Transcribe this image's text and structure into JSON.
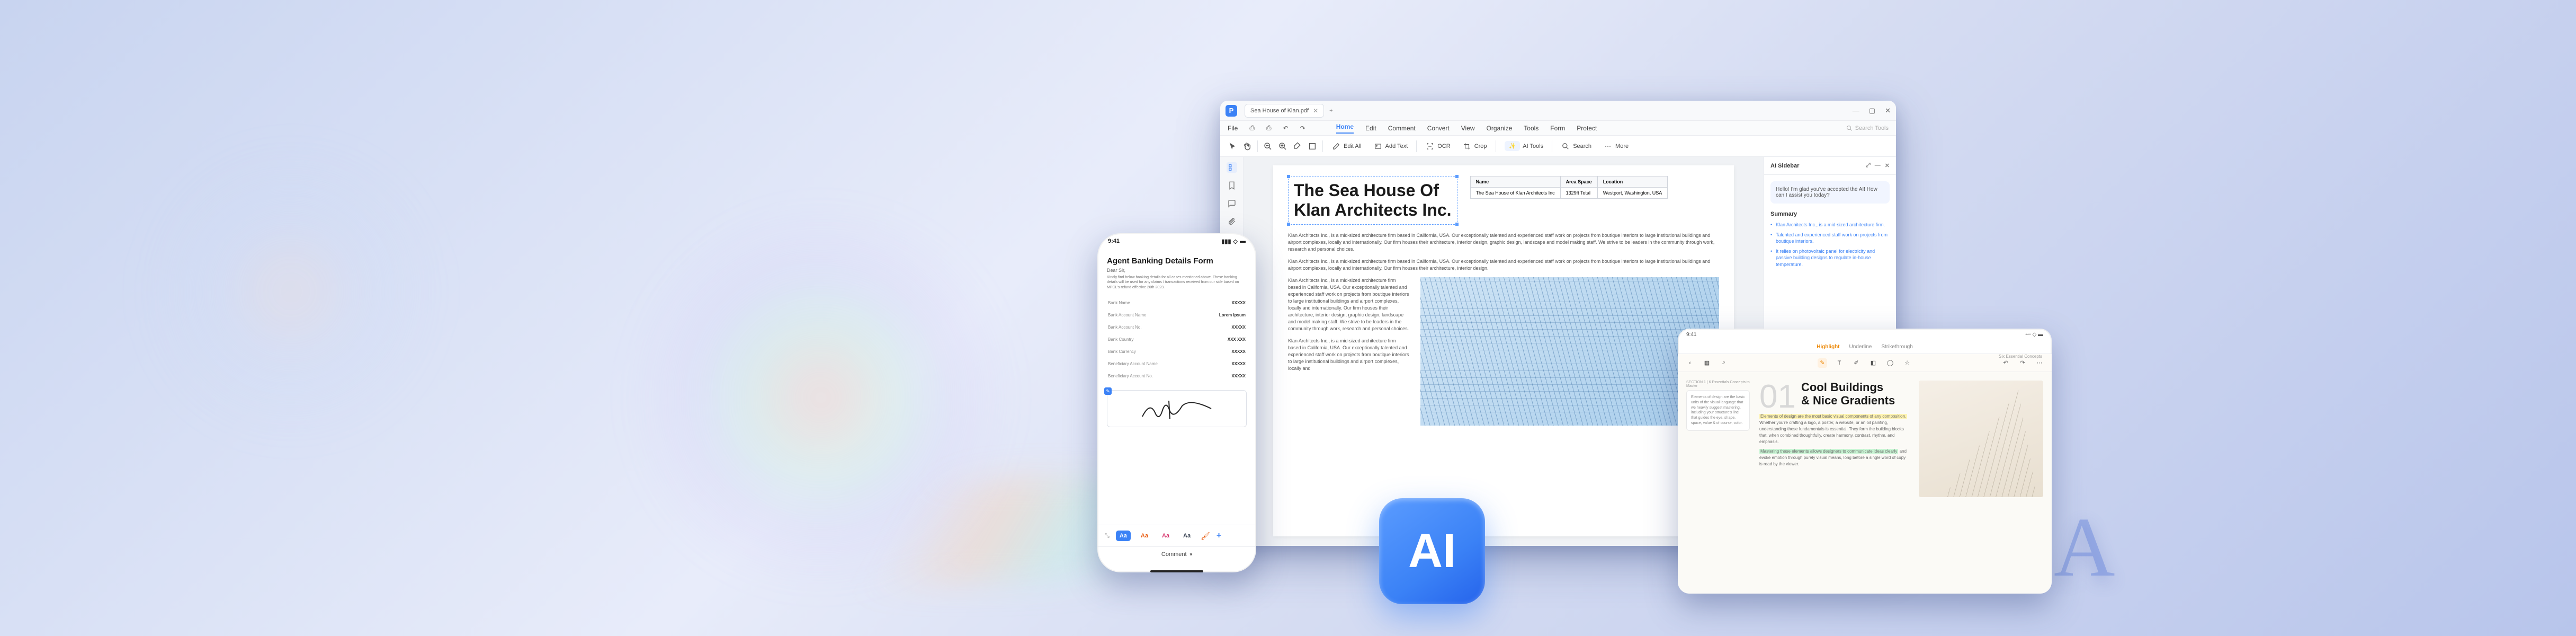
{
  "desktop": {
    "tab_title": "Sea House of Klan.pdf",
    "window_controls": {
      "min": "—",
      "max": "▢",
      "close": "✕"
    },
    "menus": {
      "file": "File",
      "home": "Home",
      "edit": "Edit",
      "comment": "Comment",
      "convert": "Convert",
      "view": "View",
      "organize": "Organize",
      "tools": "Tools",
      "form": "Form",
      "protect": "Protect"
    },
    "menu_search_placeholder": "Search Tools",
    "file_submenu": {
      "save": "⎙",
      "undo": "↶",
      "redo": "↷"
    },
    "toolbar": {
      "cursor": "Cursor",
      "hand": "Hand",
      "zoom_out": "−",
      "zoom_in": "+",
      "highlight": "Highlight",
      "shape": "Shape",
      "edit_all": "Edit All",
      "add_text": "Add Text",
      "ocr": "OCR",
      "crop": "Crop",
      "ai_tools": "AI Tools",
      "search": "Search",
      "more": "More"
    },
    "document": {
      "title_line1": "The Sea House Of",
      "title_line2": "Klan Architects Inc.",
      "table": {
        "h_name": "Name",
        "h_area": "Area Space",
        "h_location": "Location",
        "r1_name": "The Sea House of Klan Architects Inc",
        "r1_area": "1329ft Total",
        "r1_location": "Westport, Washington, USA"
      },
      "para1": "Klan Architects Inc., is a mid-sized architecture firm based in California, USA. Our exceptionally talented and experienced staff work on projects from boutique interiors to large institutional buildings and airport complexes, locally and internationally. Our firm houses their architecture, interior design, graphic design, landscape and model making staff. We strive to be leaders in the community through work, research and personal choices.",
      "para2": "Klan Architects Inc., is a mid-sized architecture firm based in California, USA. Our exceptionally talented and experienced staff work on projects from boutique interiors to large institutional buildings and airport complexes, locally and internationally. Our firm houses their architecture, interior design.",
      "side_para1": "Klan Architects Inc., is a mid-sized architecture firm based in California, USA. Our exceptionally talented and experienced staff work on projects from boutique interiors to large institutional buildings and airport complexes, locally and internationally. Our firm houses their architecture, interior design, graphic design, landscape and model making staff. We strive to be leaders in the community through work, research and personal choices.",
      "side_para2": "Klan Architects Inc., is a mid-sized architecture firm based in California, USA. Our exceptionally talented and experienced staff work on projects from boutique interiors to large institutional buildings and airport complexes, locally and"
    },
    "ai_sidebar": {
      "title": "AI Sidebar",
      "greeting": "Hello! I'm glad you've accepted the AI! How can I assist you today?",
      "section": "Summary",
      "bullets": [
        "Klan Architects Inc., is a mid-sized architecture firm.",
        "Talented and experienced staff work on projects from boutique interiors.",
        "It relies on photovoltaic panel for electricity and passive building designs to regulate in-house temperature."
      ]
    }
  },
  "ai_badge": "AI",
  "phone": {
    "time": "9:41",
    "title": "Agent Banking Details Form",
    "greeting": "Dear Sir,",
    "intro": "Kindly find below banking details for all cases mentioned above. These banking details will be used for any claims / transactions received from our side based on MPCL's refund effective 26th 2023.",
    "rows": [
      [
        "Bank Name",
        "XXXXX"
      ],
      [
        "Bank Account Name",
        "Lorem Ipsum"
      ],
      [
        "Bank Account No.",
        "XXXXX"
      ],
      [
        "Bank Country",
        "XXX XXX"
      ],
      [
        "Bank Currency",
        "XXXXX"
      ],
      [
        "Beneficiary Account Name",
        "XXXXX"
      ],
      [
        "Beneficiary Account No.",
        "XXXXX"
      ]
    ],
    "font_chips": [
      "Aa",
      "Aa",
      "Aa",
      "Aa"
    ],
    "bottom": "Comment"
  },
  "tablet": {
    "status_time": "9:41",
    "tabs": {
      "highlight": "Highlight",
      "underline": "Underline",
      "strikethrough": "Strikethrough"
    },
    "corner_label": "Six Essential Concepts",
    "heading_num": "01",
    "heading_l1": "Cool Buildings",
    "heading_l2": "& Nice Gradients",
    "subhead": "SECTION 1  |  6 Essentials Concepts to Master",
    "sidebox": "Elements of design are the basic units of the visual language that we heavily suggest mastering, including your structure's line that guides the eye, shape, space, value & of course, color.",
    "hl_text": "Elements of design are the most basic visual components of any composition.",
    "para_tail": " Whether you're crafting a logo, a poster, a website, or an oil painting, understanding these fundamentals is essential. They form the building blocks that, when combined thoughtfully, create harmony, contrast, rhythm, and emphasis.",
    "hl_text2": "Mastering these elements allows designers to communicate ideas clearly",
    "para_tail2": " and evoke emotion through purely visual means, long before a single word of copy is read by the viewer."
  },
  "decor_a": "A"
}
